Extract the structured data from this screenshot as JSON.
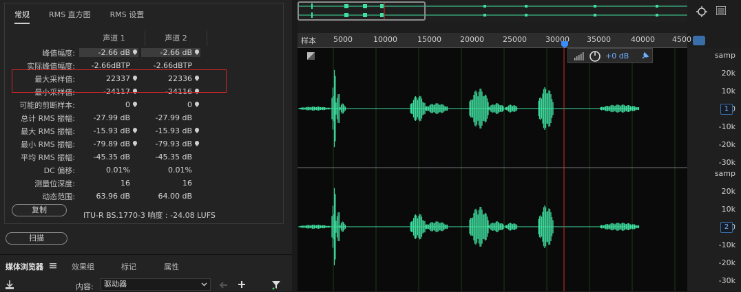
{
  "stats_tabs": [
    "常规",
    "RMS 直方图",
    "RMS 设置"
  ],
  "stats_columns": [
    "声道 1",
    "声道 2"
  ],
  "stats_rows": [
    {
      "label": "峰值幅度:",
      "ch1": "-2.66 dB",
      "ch2": "-2.66 dB",
      "pin": true,
      "highlight": true
    },
    {
      "label": "实际峰值幅度:",
      "ch1": "-2.66dBTP",
      "ch2": "-2.66dBTP",
      "pin": false
    },
    {
      "label": "最大采样值:",
      "ch1": "22337",
      "ch2": "22336",
      "pin": true
    },
    {
      "label": "最小采样值:",
      "ch1": "-24117",
      "ch2": "-24116",
      "pin": true
    },
    {
      "label": "可能的剪断样本:",
      "ch1": "0",
      "ch2": "0",
      "pin": true
    },
    {
      "label": "总计 RMS 振幅:",
      "ch1": "-27.99 dB",
      "ch2": "-27.99 dB",
      "pin": false
    },
    {
      "label": "最大 RMS 振幅:",
      "ch1": "-15.93 dB",
      "ch2": "-15.93 dB",
      "pin": true
    },
    {
      "label": "最小 RMS 振幅:",
      "ch1": "-79.89 dB",
      "ch2": "-79.93 dB",
      "pin": true
    },
    {
      "label": "平均 RMS 振幅:",
      "ch1": "-45.35 dB",
      "ch2": "-45.35 dB",
      "pin": false
    },
    {
      "label": "DC 偏移:",
      "ch1": "0.01%",
      "ch2": "0.01%",
      "pin": false
    },
    {
      "label": "测量位深度:",
      "ch1": "16",
      "ch2": "16",
      "pin": false
    },
    {
      "label": "动态范围:",
      "ch1": "63.96 dB",
      "ch2": "64.00 dB",
      "pin": false
    }
  ],
  "copy_button": "复制",
  "loudness_text": "ITU-R BS.1770-3 响度 : -24.08 LUFS",
  "scan_button": "扫描",
  "bottom_tabs": [
    "媒体浏览器",
    "效果组",
    "标记",
    "属性"
  ],
  "content_label": "内容:",
  "content_value": "驱动器",
  "ruler_label": "样本",
  "ruler_ticks": [
    "5000",
    "10000",
    "15000",
    "20000",
    "25000",
    "30000",
    "35000",
    "40000",
    "4500"
  ],
  "gain_label": "+0 dB",
  "y_unit": "samp",
  "y_ticks": [
    "20k",
    "10k",
    "0",
    "-10k",
    "-20k",
    "-30k"
  ],
  "channel_badges": [
    "1",
    "2"
  ],
  "colors": {
    "waveform": "#3fe0a0",
    "playhead": "#d03030",
    "accent": "#3b8cff",
    "highlight_box": "#d02626"
  },
  "icons": [
    "zoom-icon",
    "list-icon",
    "magnet-icon",
    "download-icon",
    "back-arrow-icon",
    "add-icon",
    "filter-icon",
    "menu-icon",
    "mixer-icon",
    "power-knob-icon",
    "pin-icon",
    "chevron-down-icon"
  ]
}
